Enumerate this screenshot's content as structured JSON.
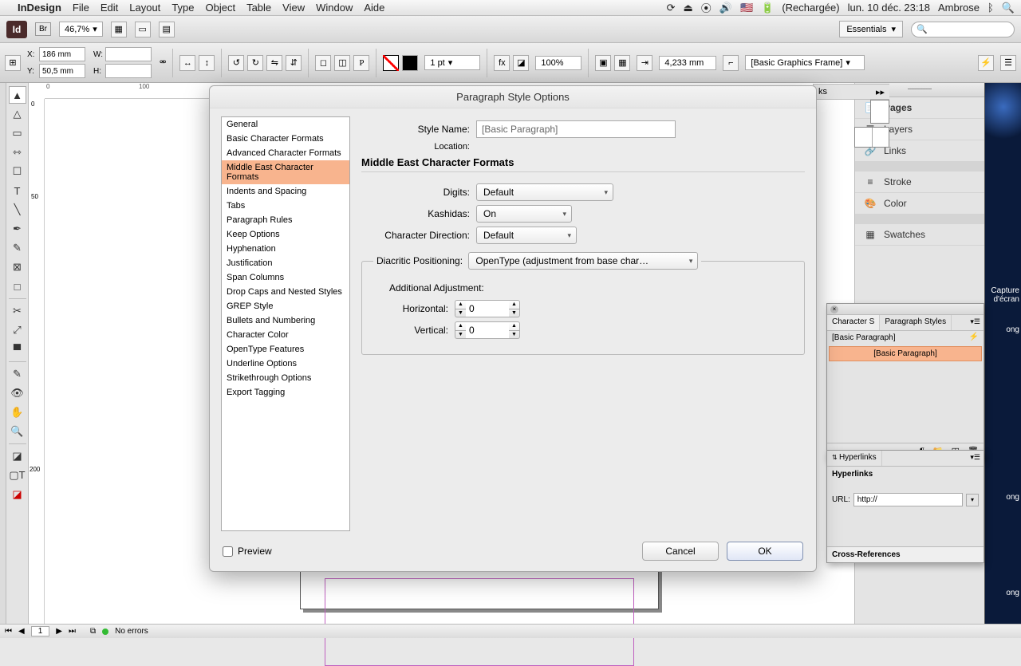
{
  "menubar": {
    "apple": "",
    "items": [
      "InDesign",
      "File",
      "Edit",
      "Layout",
      "Type",
      "Object",
      "Table",
      "View",
      "Window",
      "Aide"
    ],
    "status": "(Rechargée)",
    "datetime": "lun. 10 déc.  23:18",
    "user": "Ambrose"
  },
  "appbar": {
    "id": "Id",
    "br": "Br",
    "zoom": "46,7%",
    "workspace": "Essentials",
    "search_placeholder": ""
  },
  "controlbar": {
    "x": "186 mm",
    "y": "50,5 mm",
    "w": "",
    "h": "",
    "stroke": "1 pt",
    "offset": "4,233 mm",
    "scale": "100%",
    "preset": "[Basic Graphics Frame]"
  },
  "ruler": {
    "mark0": "0",
    "mark1": "100",
    "mark2": "50",
    "markv2": "200"
  },
  "right_panels": {
    "items": [
      "Pages",
      "Layers",
      "Links",
      "Stroke",
      "Color",
      "Swatches"
    ]
  },
  "links_tab": {
    "label": "ks",
    "chev": "▸▸"
  },
  "pstyle_panel": {
    "tabs": [
      "Character S",
      "Paragraph Styles"
    ],
    "row0": "[Basic Paragraph]",
    "selected": "[Basic Paragraph]"
  },
  "hyper_panel": {
    "title": "Hyperlinks",
    "heading": "Hyperlinks",
    "url_label": "URL:",
    "url_value": "http://",
    "xref": "Cross-References"
  },
  "dialog": {
    "title": "Paragraph Style Options",
    "categories": [
      "General",
      "Basic Character Formats",
      "Advanced Character Formats",
      "Middle East Character Formats",
      "Indents and Spacing",
      "Tabs",
      "Paragraph Rules",
      "Keep Options",
      "Hyphenation",
      "Justification",
      "Span Columns",
      "Drop Caps and Nested Styles",
      "GREP Style",
      "Bullets and Numbering",
      "Character Color",
      "OpenType Features",
      "Underline Options",
      "Strikethrough Options",
      "Export Tagging"
    ],
    "selected_category_index": 3,
    "style_name_label": "Style Name:",
    "style_name": "[Basic Paragraph]",
    "location_label": "Location:",
    "section_title": "Middle East Character Formats",
    "digits_label": "Digits:",
    "digits": "Default",
    "kashidas_label": "Kashidas:",
    "kashidas": "On",
    "chardir_label": "Character Direction:",
    "chardir": "Default",
    "diacritic_legend": "Diacritic Positioning:",
    "diacritic": "OpenType (adjustment from base char…",
    "additional_heading": "Additional Adjustment:",
    "horizontal_label": "Horizontal:",
    "horizontal": "0",
    "vertical_label": "Vertical:",
    "vertical": "0",
    "preview": "Preview",
    "cancel": "Cancel",
    "ok": "OK"
  },
  "statusbar": {
    "page": "1",
    "errors": "No errors"
  },
  "desktop": {
    "cap": "Capture d'écran",
    "ong": "ong"
  }
}
